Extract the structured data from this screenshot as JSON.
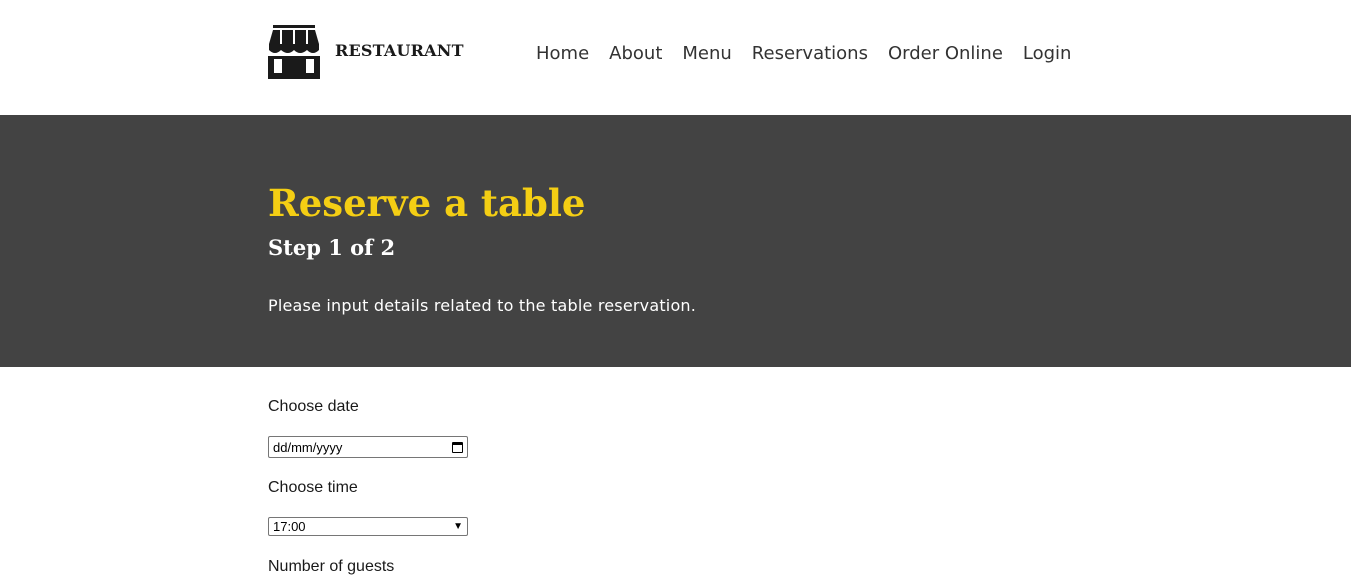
{
  "header": {
    "brand": "RESTAURANT",
    "logo_icon": "storefront-icon",
    "nav": [
      "Home",
      "About",
      "Menu",
      "Reservations",
      "Order Online",
      "Login"
    ]
  },
  "hero": {
    "title": "Reserve a table",
    "step": "Step 1 of 2",
    "description": "Please input details related to the table reservation."
  },
  "form": {
    "date_label": "Choose date",
    "date_placeholder": "dd/mm/yyyy",
    "time_label": "Choose time",
    "time_value": "17:00",
    "guests_label": "Number of guests"
  },
  "colors": {
    "hero_bg": "#434343",
    "accent": "#f4ce14"
  }
}
